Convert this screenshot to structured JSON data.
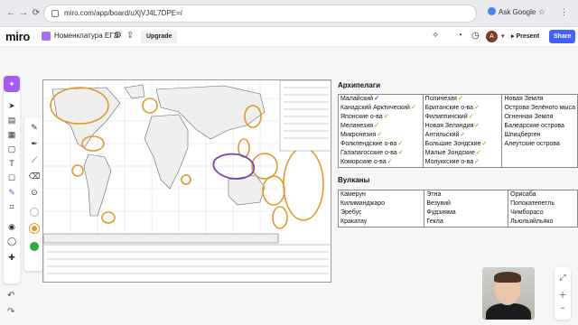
{
  "browser": {
    "url": "miro.com/app/board/uXjVJ4L7DPE=/",
    "ask_label": "Ask Google",
    "nav": {
      "back": "←",
      "forward": "→",
      "reload": "⟳"
    },
    "icons": [
      "star-icon",
      "menu-icon"
    ]
  },
  "miro": {
    "logo": "miro",
    "board_name": "Номенклатура ЕГЭ",
    "upgrade_label": "Upgrade",
    "present_label": "Present",
    "share_label": "Share",
    "avatar_letter": "A"
  },
  "archipelagos": {
    "title": "Архипелаги",
    "rows": [
      [
        {
          "t": "Малайский",
          "c": "blue"
        },
        {
          "t": "Полинезия",
          "c": "orange"
        },
        {
          "t": "Новая Земля",
          "c": ""
        }
      ],
      [
        {
          "t": "Канадский Арктический",
          "c": "orange"
        },
        {
          "t": "Британские о-ва",
          "c": "orange"
        },
        {
          "t": "Острова Зелёного мыса",
          "c": ""
        }
      ],
      [
        {
          "t": "Японские о-ва",
          "c": "orange"
        },
        {
          "t": "Филиппинский",
          "c": "orange"
        },
        {
          "t": "Огненная Земля",
          "c": ""
        }
      ],
      [
        {
          "t": "Меланезия",
          "c": "orange"
        },
        {
          "t": "Новая Зеландия",
          "c": "orange"
        },
        {
          "t": "Балеарские острова",
          "c": ""
        }
      ],
      [
        {
          "t": "Микронезия",
          "c": "orange"
        },
        {
          "t": "Антильский",
          "c": "orange"
        },
        {
          "t": "Шпицберген",
          "c": ""
        }
      ],
      [
        {
          "t": "Фолклендские о-ва",
          "c": "orange"
        },
        {
          "t": "Большие Зондские",
          "c": "orange"
        },
        {
          "t": "Алеутские острова",
          "c": ""
        }
      ],
      [
        {
          "t": "Галапагосские о-ва",
          "c": "orange"
        },
        {
          "t": "Малые Зондские",
          "c": "orange"
        },
        {
          "t": "",
          "c": ""
        }
      ],
      [
        {
          "t": "Коморские о-ва",
          "c": "orange"
        },
        {
          "t": "Молуккские о-ва",
          "c": "orange"
        },
        {
          "t": "",
          "c": ""
        }
      ]
    ]
  },
  "volcanoes": {
    "title": "Вулканы",
    "rows": [
      [
        "Камерун",
        "Этна",
        "Орисаба"
      ],
      [
        "Килиманджаро",
        "Везувий",
        "Попокатепетль"
      ],
      [
        "Эребус",
        "Фудзияма",
        "Чимборасо"
      ],
      [
        "Кракатау",
        "Гекла",
        "Льюльяйльяко"
      ]
    ]
  },
  "colors": {
    "accent": "#4262ff",
    "ai": "#a45cf5",
    "annotation_orange": "#e09a2a",
    "annotation_blue": "#2b50d8",
    "annotation_purple": "#7a3fbf"
  }
}
